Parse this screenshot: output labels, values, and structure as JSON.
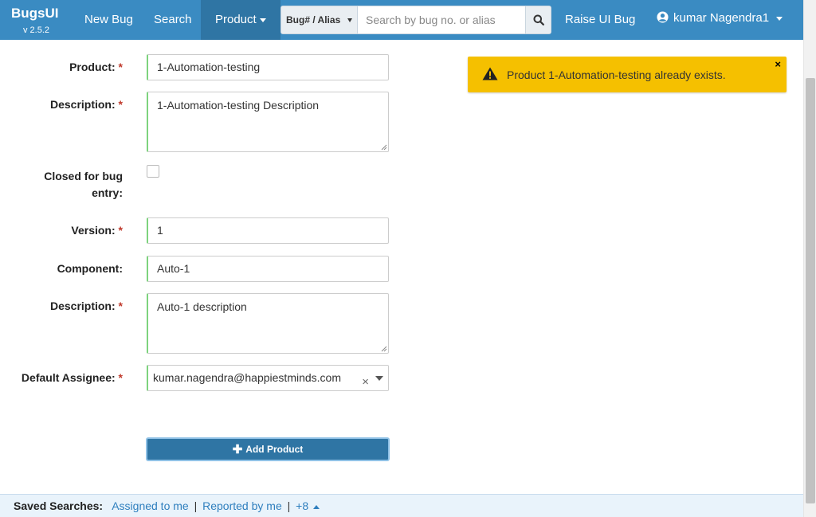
{
  "navbar": {
    "brand": "BugsUI",
    "version": "v 2.5.2",
    "new_bug": "New Bug",
    "search": "Search",
    "product": "Product",
    "search_type": "Bug# / Alias",
    "search_placeholder": "Search by bug no. or alias",
    "raise_ui_bug": "Raise UI Bug",
    "user": "kumar Nagendra1",
    "colors": {
      "background": "#3a8bc2",
      "active": "#2f75a4"
    }
  },
  "form": {
    "product_label": "Product:",
    "product_value": "1-Automation-testing",
    "description_label": "Description:",
    "description_value": "1-Automation-testing Description",
    "closed_label_line1": "Closed for bug",
    "closed_label_line2": "entry:",
    "closed_checked": false,
    "version_label": "Version:",
    "version_value": "1",
    "component_label": "Component:",
    "component_value": "Auto-1",
    "component_description_label": "Description:",
    "component_description_value": "Auto-1 description",
    "assignee_label": "Default Assignee:",
    "assignee_value": "kumar.nagendra@happiestminds.com",
    "clear_symbol": "×",
    "required_marker": "*",
    "submit_label": "Add Product"
  },
  "alert": {
    "message": "Product 1-Automation-testing already exists.",
    "close_symbol": "×",
    "color": "#f5c000"
  },
  "footer": {
    "label": "Saved Searches:",
    "assigned_to_me": "Assigned to me",
    "reported_by_me": "Reported by me",
    "more": "+8",
    "separator": "|"
  }
}
